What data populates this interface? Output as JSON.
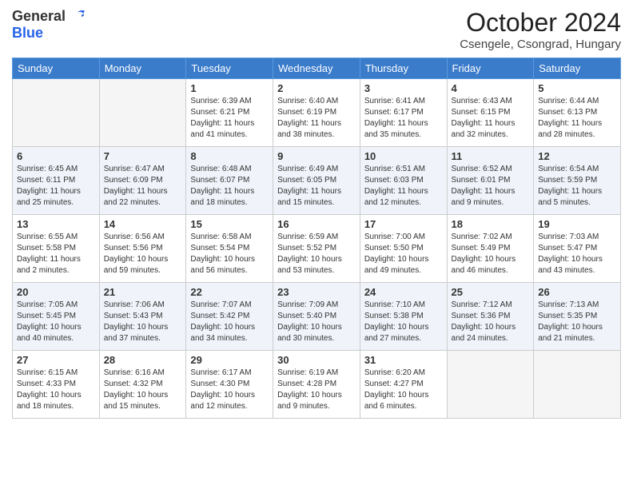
{
  "header": {
    "logo_general": "General",
    "logo_blue": "Blue",
    "title": "October 2024",
    "location": "Csengele, Csongrad, Hungary"
  },
  "days_of_week": [
    "Sunday",
    "Monday",
    "Tuesday",
    "Wednesday",
    "Thursday",
    "Friday",
    "Saturday"
  ],
  "weeks": [
    [
      {
        "day": "",
        "sunrise": "",
        "sunset": "",
        "daylight": ""
      },
      {
        "day": "",
        "sunrise": "",
        "sunset": "",
        "daylight": ""
      },
      {
        "day": "1",
        "sunrise": "Sunrise: 6:39 AM",
        "sunset": "Sunset: 6:21 PM",
        "daylight": "Daylight: 11 hours and 41 minutes."
      },
      {
        "day": "2",
        "sunrise": "Sunrise: 6:40 AM",
        "sunset": "Sunset: 6:19 PM",
        "daylight": "Daylight: 11 hours and 38 minutes."
      },
      {
        "day": "3",
        "sunrise": "Sunrise: 6:41 AM",
        "sunset": "Sunset: 6:17 PM",
        "daylight": "Daylight: 11 hours and 35 minutes."
      },
      {
        "day": "4",
        "sunrise": "Sunrise: 6:43 AM",
        "sunset": "Sunset: 6:15 PM",
        "daylight": "Daylight: 11 hours and 32 minutes."
      },
      {
        "day": "5",
        "sunrise": "Sunrise: 6:44 AM",
        "sunset": "Sunset: 6:13 PM",
        "daylight": "Daylight: 11 hours and 28 minutes."
      }
    ],
    [
      {
        "day": "6",
        "sunrise": "Sunrise: 6:45 AM",
        "sunset": "Sunset: 6:11 PM",
        "daylight": "Daylight: 11 hours and 25 minutes."
      },
      {
        "day": "7",
        "sunrise": "Sunrise: 6:47 AM",
        "sunset": "Sunset: 6:09 PM",
        "daylight": "Daylight: 11 hours and 22 minutes."
      },
      {
        "day": "8",
        "sunrise": "Sunrise: 6:48 AM",
        "sunset": "Sunset: 6:07 PM",
        "daylight": "Daylight: 11 hours and 18 minutes."
      },
      {
        "day": "9",
        "sunrise": "Sunrise: 6:49 AM",
        "sunset": "Sunset: 6:05 PM",
        "daylight": "Daylight: 11 hours and 15 minutes."
      },
      {
        "day": "10",
        "sunrise": "Sunrise: 6:51 AM",
        "sunset": "Sunset: 6:03 PM",
        "daylight": "Daylight: 11 hours and 12 minutes."
      },
      {
        "day": "11",
        "sunrise": "Sunrise: 6:52 AM",
        "sunset": "Sunset: 6:01 PM",
        "daylight": "Daylight: 11 hours and 9 minutes."
      },
      {
        "day": "12",
        "sunrise": "Sunrise: 6:54 AM",
        "sunset": "Sunset: 5:59 PM",
        "daylight": "Daylight: 11 hours and 5 minutes."
      }
    ],
    [
      {
        "day": "13",
        "sunrise": "Sunrise: 6:55 AM",
        "sunset": "Sunset: 5:58 PM",
        "daylight": "Daylight: 11 hours and 2 minutes."
      },
      {
        "day": "14",
        "sunrise": "Sunrise: 6:56 AM",
        "sunset": "Sunset: 5:56 PM",
        "daylight": "Daylight: 10 hours and 59 minutes."
      },
      {
        "day": "15",
        "sunrise": "Sunrise: 6:58 AM",
        "sunset": "Sunset: 5:54 PM",
        "daylight": "Daylight: 10 hours and 56 minutes."
      },
      {
        "day": "16",
        "sunrise": "Sunrise: 6:59 AM",
        "sunset": "Sunset: 5:52 PM",
        "daylight": "Daylight: 10 hours and 53 minutes."
      },
      {
        "day": "17",
        "sunrise": "Sunrise: 7:00 AM",
        "sunset": "Sunset: 5:50 PM",
        "daylight": "Daylight: 10 hours and 49 minutes."
      },
      {
        "day": "18",
        "sunrise": "Sunrise: 7:02 AM",
        "sunset": "Sunset: 5:49 PM",
        "daylight": "Daylight: 10 hours and 46 minutes."
      },
      {
        "day": "19",
        "sunrise": "Sunrise: 7:03 AM",
        "sunset": "Sunset: 5:47 PM",
        "daylight": "Daylight: 10 hours and 43 minutes."
      }
    ],
    [
      {
        "day": "20",
        "sunrise": "Sunrise: 7:05 AM",
        "sunset": "Sunset: 5:45 PM",
        "daylight": "Daylight: 10 hours and 40 minutes."
      },
      {
        "day": "21",
        "sunrise": "Sunrise: 7:06 AM",
        "sunset": "Sunset: 5:43 PM",
        "daylight": "Daylight: 10 hours and 37 minutes."
      },
      {
        "day": "22",
        "sunrise": "Sunrise: 7:07 AM",
        "sunset": "Sunset: 5:42 PM",
        "daylight": "Daylight: 10 hours and 34 minutes."
      },
      {
        "day": "23",
        "sunrise": "Sunrise: 7:09 AM",
        "sunset": "Sunset: 5:40 PM",
        "daylight": "Daylight: 10 hours and 30 minutes."
      },
      {
        "day": "24",
        "sunrise": "Sunrise: 7:10 AM",
        "sunset": "Sunset: 5:38 PM",
        "daylight": "Daylight: 10 hours and 27 minutes."
      },
      {
        "day": "25",
        "sunrise": "Sunrise: 7:12 AM",
        "sunset": "Sunset: 5:36 PM",
        "daylight": "Daylight: 10 hours and 24 minutes."
      },
      {
        "day": "26",
        "sunrise": "Sunrise: 7:13 AM",
        "sunset": "Sunset: 5:35 PM",
        "daylight": "Daylight: 10 hours and 21 minutes."
      }
    ],
    [
      {
        "day": "27",
        "sunrise": "Sunrise: 6:15 AM",
        "sunset": "Sunset: 4:33 PM",
        "daylight": "Daylight: 10 hours and 18 minutes."
      },
      {
        "day": "28",
        "sunrise": "Sunrise: 6:16 AM",
        "sunset": "Sunset: 4:32 PM",
        "daylight": "Daylight: 10 hours and 15 minutes."
      },
      {
        "day": "29",
        "sunrise": "Sunrise: 6:17 AM",
        "sunset": "Sunset: 4:30 PM",
        "daylight": "Daylight: 10 hours and 12 minutes."
      },
      {
        "day": "30",
        "sunrise": "Sunrise: 6:19 AM",
        "sunset": "Sunset: 4:28 PM",
        "daylight": "Daylight: 10 hours and 9 minutes."
      },
      {
        "day": "31",
        "sunrise": "Sunrise: 6:20 AM",
        "sunset": "Sunset: 4:27 PM",
        "daylight": "Daylight: 10 hours and 6 minutes."
      },
      {
        "day": "",
        "sunrise": "",
        "sunset": "",
        "daylight": ""
      },
      {
        "day": "",
        "sunrise": "",
        "sunset": "",
        "daylight": ""
      }
    ]
  ]
}
